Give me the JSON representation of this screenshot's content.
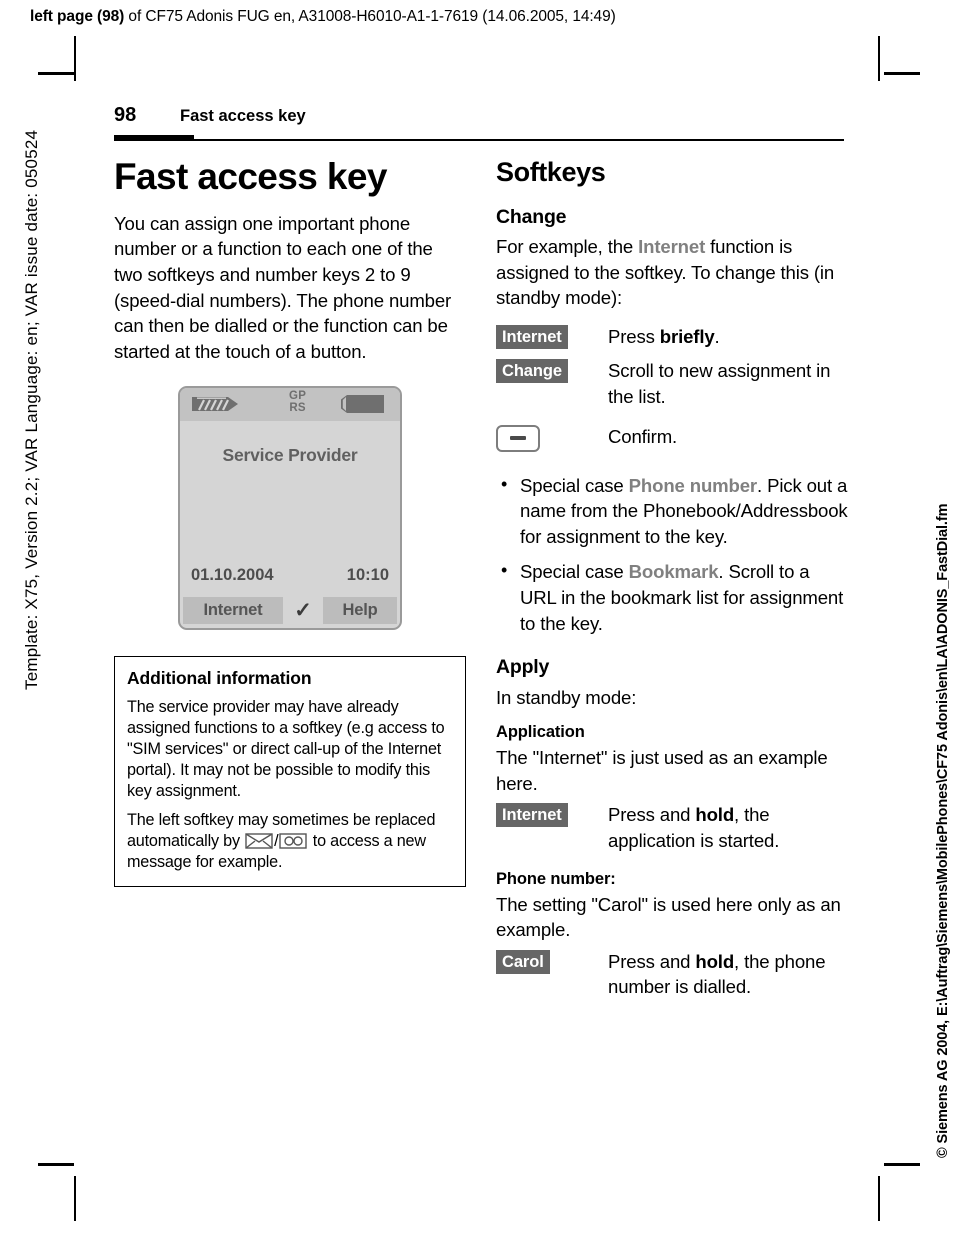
{
  "running_header": {
    "bold_prefix": "left page (98)",
    "rest": " of CF75 Adonis FUG en, A31008-H6010-A1-1-7619 (14.06.2005, 14:49)"
  },
  "side_text": {
    "left": "Template: X75, Version 2.2; VAR Language: en; VAR issue date: 050524",
    "right": "© Siemens AG 2004, E:\\Auftrag\\Siemens\\MobilePhones\\CF75 Adonis\\en\\LA\\ADONIS_FastDial.fm"
  },
  "page_header": {
    "page_number": "98",
    "running_title": "Fast access key"
  },
  "left_column": {
    "chapter_title": "Fast access key",
    "intro": "You can assign one important phone number or a function to each one of the two softkeys and number keys 2 to 9 (speed-dial numbers). The phone number can then be dialled or the function can be started at the touch of a button.",
    "phone": {
      "gprs_line1": "GP",
      "gprs_line2": "RS",
      "provider": "Service Provider",
      "date": "01.10.2004",
      "time": "10:10",
      "softkey_left": "Internet",
      "softkey_right": "Help",
      "center_icon": "✓"
    },
    "infobox": {
      "title": "Additional information",
      "paragraph1": "The service provider may have already assigned functions to a softkey (e.g access to \"SIM services\" or direct call-up of the Internet portal). It may not be possible to modify this key assignment.",
      "paragraph2_part1": "The left softkey may sometimes be replaced automatically by ",
      "paragraph2_sep": "/",
      "paragraph2_part2": " to access a new message for example."
    }
  },
  "right_column": {
    "section_title": "Softkeys",
    "change": {
      "heading": "Change",
      "intro_part1": "For example, the ",
      "intro_term": "Internet",
      "intro_part2": " function is assigned to the softkey. To change this (in standby mode):",
      "rows": [
        {
          "key": "Internet",
          "key_type": "label",
          "desc_part1": "Press ",
          "desc_bold": "briefly",
          "desc_part2": "."
        },
        {
          "key": "Change",
          "key_type": "label",
          "desc_part1": "Scroll to new assignment in the list.",
          "desc_bold": "",
          "desc_part2": ""
        },
        {
          "key": "",
          "key_type": "hardware",
          "desc_part1": "Confirm.",
          "desc_bold": "",
          "desc_part2": ""
        }
      ],
      "bullets": [
        {
          "part1": "Special case ",
          "term": "Phone number",
          "part2": ". Pick out a name from the Phonebook/Addressbook for assignment to the key."
        },
        {
          "part1": "Special case ",
          "term": "Bookmark",
          "part2": ". Scroll to a URL in the bookmark list for assignment to the key."
        }
      ]
    },
    "apply": {
      "heading": "Apply",
      "intro": "In standby mode:",
      "application_heading": "Application",
      "application_text": "The \"Internet\" is just used as an example here.",
      "application_row": {
        "key": "Internet",
        "desc_part1": "Press and ",
        "desc_bold": "hold",
        "desc_part2": ", the application is started."
      },
      "phone_number_heading": "Phone number:",
      "phone_number_text": "The setting \"Carol\" is used here only as an example.",
      "phone_number_row": {
        "key": "Carol",
        "desc_part1": "Press and ",
        "desc_bold": "hold",
        "desc_part2": ", the phone number is dialled."
      }
    }
  },
  "colors": {
    "key_label_bg": "#666666",
    "gray_term": "#808080",
    "phone_screen": "#d5d5d5",
    "phone_status_bar": "#c2c2c2",
    "phone_softkey": "#bcbcbc"
  }
}
